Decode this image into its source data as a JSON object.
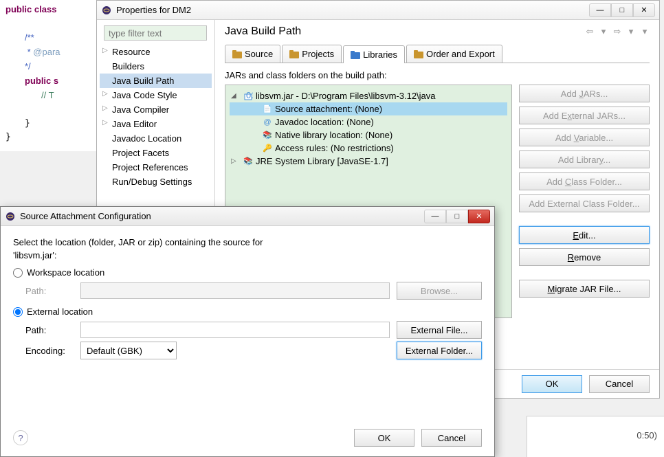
{
  "code": {
    "l1": "public class",
    "l2": "/**",
    "l3": " * @para",
    "l4": " */",
    "l5": "public s",
    "l6": "// T",
    "l7": "}",
    "l8": "}"
  },
  "properties": {
    "title": "Properties for DM2",
    "filterPlaceholder": "type filter text",
    "sidebarItems": [
      {
        "label": "Resource",
        "caret": true
      },
      {
        "label": "Builders"
      },
      {
        "label": "Java Build Path",
        "selected": true
      },
      {
        "label": "Java Code Style",
        "caret": true
      },
      {
        "label": "Java Compiler",
        "caret": true
      },
      {
        "label": "Java Editor",
        "caret": true
      },
      {
        "label": "Javadoc Location"
      },
      {
        "label": "Project Facets"
      },
      {
        "label": "Project References"
      },
      {
        "label": "Run/Debug Settings"
      }
    ],
    "heading": "Java Build Path",
    "tabs": [
      {
        "label": "Source",
        "iconColor": "#c9952e"
      },
      {
        "label": "Projects",
        "iconColor": "#c9952e"
      },
      {
        "label": "Libraries",
        "active": true,
        "iconColor": "#3a7acb"
      },
      {
        "label": "Order and Export",
        "iconColor": "#c9952e"
      }
    ],
    "jarLabel": "JARs and class folders on the build path:",
    "jarTree": {
      "root": "libsvm.jar - D:\\Program Files\\libsvm-3.12\\java",
      "children": [
        "Source attachment: (None)",
        "Javadoc location: (None)",
        "Native library location: (None)",
        "Access rules: (No restrictions)"
      ],
      "sibling": "JRE System Library [JavaSE-1.7]"
    },
    "buttons": {
      "addJars": "Add JARs...",
      "addExtJars": "Add External JARs...",
      "addVar": "Add Variable...",
      "addLib": "Add Library...",
      "addClass": "Add Class Folder...",
      "addExtClass": "Add External Class Folder...",
      "edit": "Edit...",
      "remove": "Remove",
      "migrate": "Migrate JAR File..."
    },
    "ok": "OK",
    "cancel": "Cancel"
  },
  "sourceAttach": {
    "title": "Source Attachment Configuration",
    "prompt1": "Select the location (folder, JAR or zip) containing the source for",
    "prompt2": "'libsvm.jar':",
    "workspaceLoc": "Workspace location",
    "externalLoc": "External location",
    "pathLabel": "Path:",
    "encodingLabel": "Encoding:",
    "encodingValue": "Default (GBK)",
    "browse": "Browse...",
    "externalFile": "External File...",
    "externalFolder": "External Folder...",
    "ok": "OK",
    "cancel": "Cancel"
  },
  "statusFrag": "0:50)"
}
